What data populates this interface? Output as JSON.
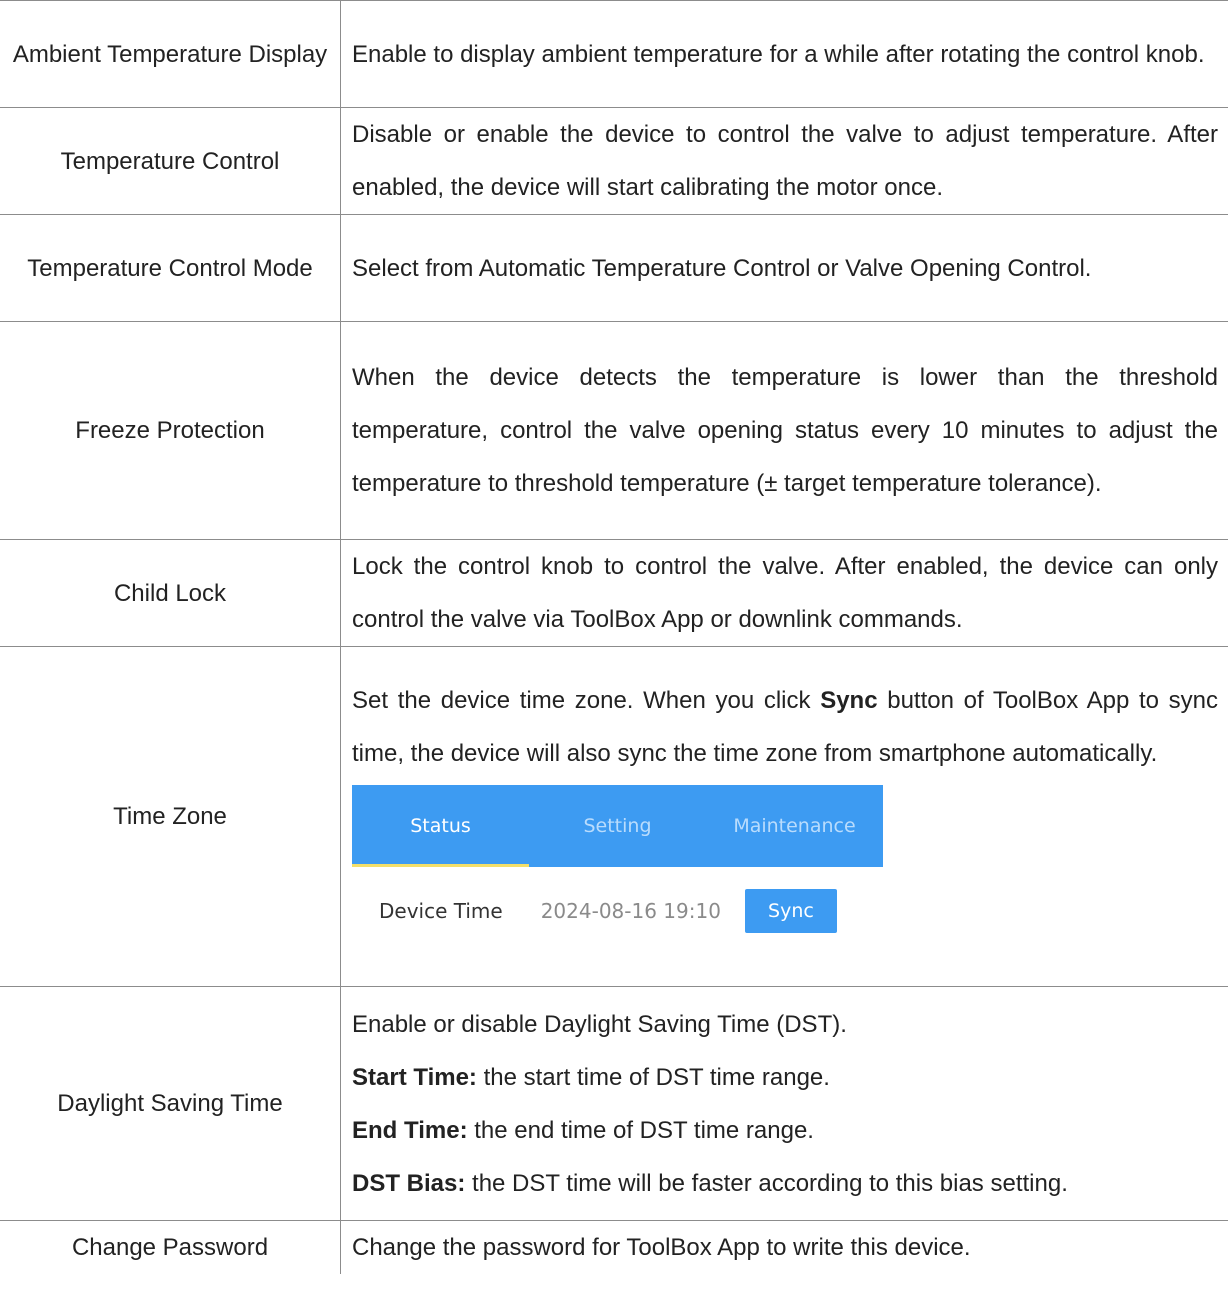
{
  "rows": [
    {
      "name": "Ambient Temperature Display",
      "desc": "Enable to display ambient temperature for a while after rotating the control knob."
    },
    {
      "name": "Temperature Control",
      "desc": "Disable or enable the device to control the valve to adjust temperature. After enabled, the device will start calibrating the motor once."
    },
    {
      "name": "Temperature Control Mode",
      "desc": "Select from Automatic Temperature Control or Valve Opening Control."
    },
    {
      "name": "Freeze Protection",
      "desc": "When the device detects the temperature is lower than the threshold temperature, control the valve opening status every 10 minutes to adjust the temperature to threshold temperature (± target temperature tolerance)."
    },
    {
      "name": "Child Lock",
      "desc": "Lock the control knob to control the valve. After enabled, the device can only control the valve via ToolBox App or downlink commands."
    },
    {
      "name": "Time Zone",
      "desc_before": "Set the device time zone. When you click ",
      "desc_bold": "Sync",
      "desc_after": " button of ToolBox App to sync time, the device will also sync the time zone from smartphone automatically.",
      "screenshot": {
        "tabs": [
          "Status",
          "Setting",
          "Maintenance"
        ],
        "active_tab": "Status",
        "device_time_label": "Device Time",
        "device_time_value": "2024-08-16 19:10",
        "sync_label": "Sync",
        "colors": {
          "tab_bar": "#3d9bf2",
          "active_indicator": "#f3df6a",
          "sync_button": "#3d9bf2"
        }
      }
    },
    {
      "name": "Daylight Saving Time",
      "lines": [
        {
          "label": "",
          "text": "Enable or disable Daylight Saving Time (DST)."
        },
        {
          "label": "Start Time:",
          "text": " the start time of DST time range."
        },
        {
          "label": "End Time:",
          "text": " the end time of DST time range."
        },
        {
          "label": "DST Bias:",
          "text": " the DST time will be faster according to this bias setting."
        }
      ]
    },
    {
      "name": "Change Password",
      "desc": "Change the password for ToolBox App to write this device."
    }
  ]
}
